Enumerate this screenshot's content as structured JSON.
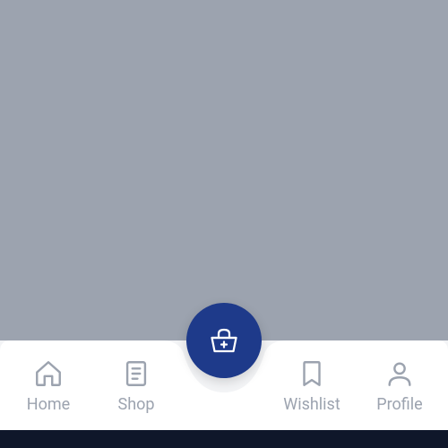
{
  "nav": {
    "items": [
      {
        "label": "Home",
        "icon": "home-icon"
      },
      {
        "label": "Shop",
        "icon": "receipt-icon"
      },
      {
        "label": "Wishlist",
        "icon": "bookmark-icon"
      },
      {
        "label": "Profile",
        "icon": "user-icon"
      }
    ],
    "fab": {
      "icon": "basket-plus-icon",
      "color": "#1e3a8a"
    }
  }
}
